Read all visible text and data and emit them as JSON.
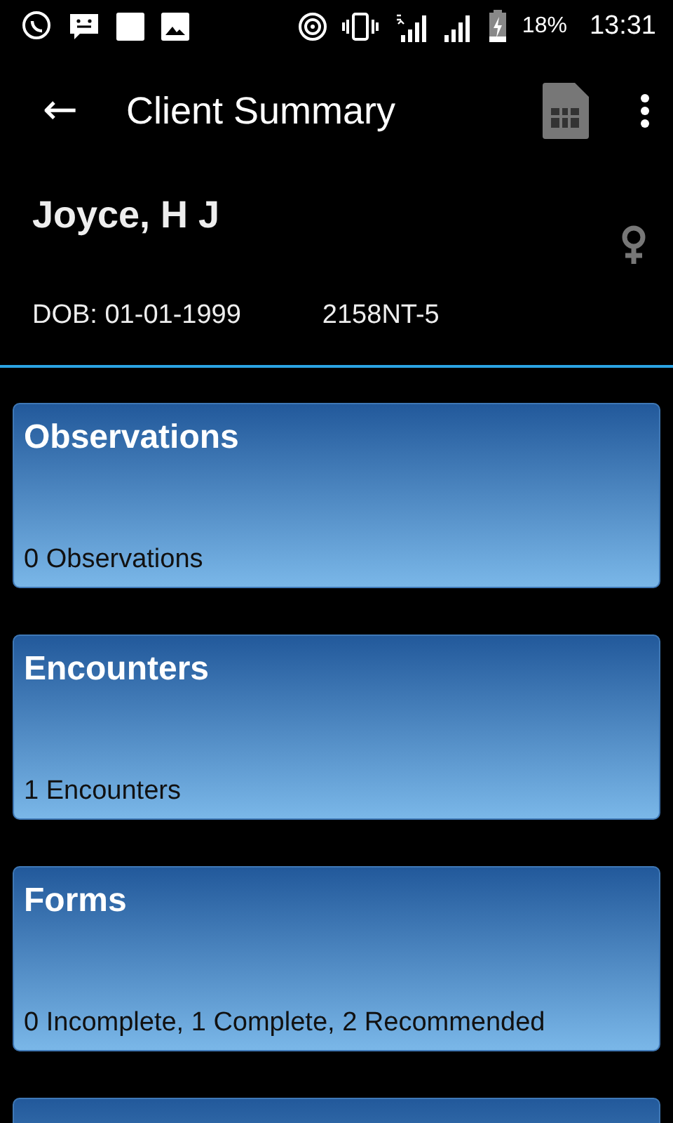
{
  "status_bar": {
    "battery": "18%",
    "time": "13:31"
  },
  "app_bar": {
    "back": "←",
    "title": "Client Summary"
  },
  "client": {
    "name": "Joyce, H J",
    "dob": "DOB: 01-01-1999",
    "id": "2158NT-5"
  },
  "cards": [
    {
      "title": "Observations",
      "summary": "0 Observations"
    },
    {
      "title": "Encounters",
      "summary": "1 Encounters"
    },
    {
      "title": "Forms",
      "summary": "0 Incomplete, 1 Complete, 2 Recommended"
    }
  ],
  "partial_card": true
}
